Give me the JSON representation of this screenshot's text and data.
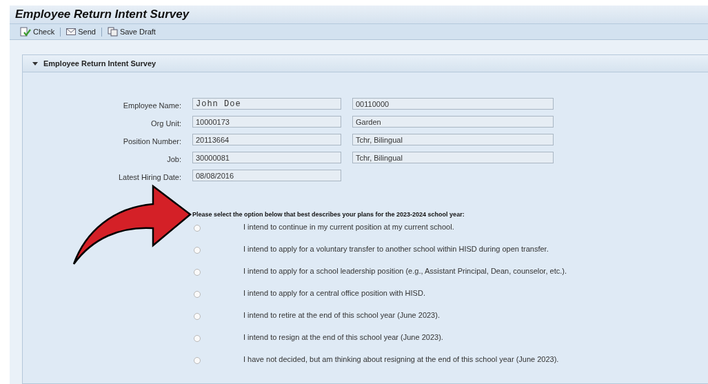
{
  "window": {
    "title": "Employee Return Intent Survey"
  },
  "toolbar": [
    {
      "label": "Check",
      "kind": "check"
    },
    {
      "label": "Send",
      "kind": "send"
    },
    {
      "label": "Save Draft",
      "kind": "save"
    }
  ],
  "panel": {
    "title": "Employee Return Intent Survey",
    "expanded": true
  },
  "fields": [
    {
      "label": "Employee Name:",
      "value": "John Doe",
      "secondary": "00110000",
      "mono": true
    },
    {
      "label": "Org Unit:",
      "value": "10000173",
      "secondary": "Garden"
    },
    {
      "label": "Position Number:",
      "value": "20113664",
      "secondary": "Tchr, Bilingual"
    },
    {
      "label": "Job:",
      "value": "30000081",
      "secondary": "Tchr, Bilingual"
    },
    {
      "label": "Latest Hiring Date:",
      "value": "08/08/2016"
    }
  ],
  "question": "Please select the option below that best describes your plans for the 2023-2024 school year:",
  "options": [
    {
      "label": "I intend to continue in my current position at my current school.",
      "selected": false
    },
    {
      "label": "I intend to apply for a voluntary transfer to another school within HISD during open transfer.",
      "selected": false
    },
    {
      "label": "I intend to apply for a school leadership position (e.g., Assistant Principal, Dean, counselor, etc.).",
      "selected": false
    },
    {
      "label": "I intend to apply for a central office position with HISD.",
      "selected": false
    },
    {
      "label": "I intend to retire at the end of this school year (June 2023).",
      "selected": false
    },
    {
      "label": "I intend to resign at the end of this school year (June 2023).",
      "selected": false
    },
    {
      "label": "I have not decided, but am thinking about resigning at the end of this school year (June 2023).",
      "selected": false
    }
  ]
}
